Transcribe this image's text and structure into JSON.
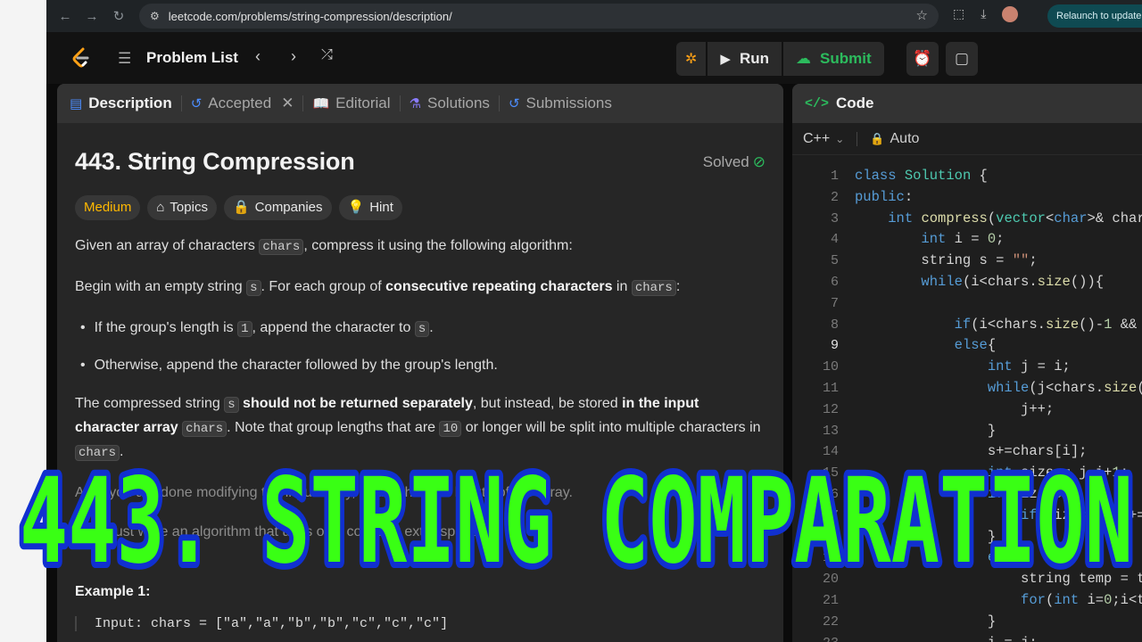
{
  "browser": {
    "url": "leetcode.com/problems/string-compression/description/",
    "relaunch_label": "Relaunch to update"
  },
  "topbar": {
    "problem_list_label": "Problem List",
    "run_label": "Run",
    "submit_label": "Submit"
  },
  "tabs": [
    {
      "label": "Description"
    },
    {
      "label": "Accepted"
    },
    {
      "label": "Editorial"
    },
    {
      "label": "Solutions"
    },
    {
      "label": "Submissions"
    }
  ],
  "problem": {
    "title": "443. String Compression",
    "status": "Solved",
    "chips": [
      "Medium",
      "Topics",
      "Companies",
      "Hint"
    ],
    "p1_a": "Given an array of characters ",
    "p1_code": "chars",
    "p1_b": ", compress it using the following algorithm:",
    "p2_a": "Begin with an empty string ",
    "p2_code1": "s",
    "p2_b": ". For each group of ",
    "p2_bold": "consecutive repeating characters",
    "p2_c": " in ",
    "p2_code2": "chars",
    "p2_d": ":",
    "b1_a": "If the group's length is ",
    "b1_code1": "1",
    "b1_b": ", append the character to ",
    "b1_code2": "s",
    "b1_c": ".",
    "b2": "Otherwise, append the character followed by the group's length.",
    "p3_a": "The compressed string ",
    "p3_code1": "s",
    "p3_bold1": " should not be returned separately",
    "p3_b": ", but instead, be stored ",
    "p3_bold2": "in the input character array",
    "p3_code2": "chars",
    "p3_c": ". Note that group lengths that are ",
    "p3_code3": "10",
    "p3_d": " or longer will be split into multiple characters in ",
    "p3_code4": "chars",
    "p3_e": ".",
    "p4": "After you are done modifying the input array, return the new length of the array.",
    "p5": "You must write an algorithm that uses only constant extra space.",
    "example_title": "Example 1:",
    "example_input": "Input: chars = [\"a\",\"a\",\"b\",\"b\",\"c\",\"c\",\"c\"]"
  },
  "code": {
    "header": "Code",
    "language": "C++",
    "mode": "Auto",
    "line_numbers": [
      "1",
      "2",
      "3",
      "4",
      "5",
      "6",
      "7",
      "8",
      "9",
      "10",
      "11",
      "12",
      "13",
      "14",
      "15",
      "16",
      "17",
      "18",
      "19",
      "20",
      "21",
      "22",
      "23"
    ],
    "highlight_line": "9"
  },
  "overlay": {
    "text": "443. STRING COMPARATION",
    "fill_color": "#39ff14",
    "outline_color": "#1030d0"
  },
  "colors": {
    "accent_green": "#2cbb5d",
    "medium": "#ffb800",
    "accent_blue": "#4c8dff"
  }
}
